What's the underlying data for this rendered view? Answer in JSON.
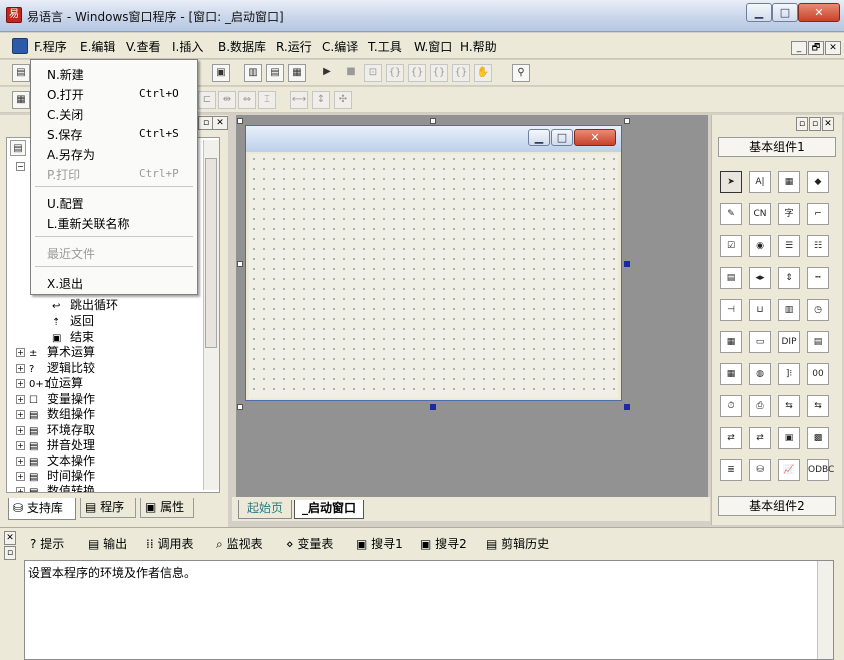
{
  "window": {
    "title": "易语言 - Windows窗口程序 - [窗口: _启动窗口]",
    "app_icon": "易",
    "min_label": "▁",
    "max_label": "□",
    "close_label": "✕"
  },
  "menubar": {
    "items": [
      {
        "label": "F.程序"
      },
      {
        "label": "E.编辑"
      },
      {
        "label": "V.查看"
      },
      {
        "label": "I.插入"
      },
      {
        "label": "B.数据库"
      },
      {
        "label": "R.运行"
      },
      {
        "label": "C.编译"
      },
      {
        "label": "T.工具"
      },
      {
        "label": "W.窗口"
      },
      {
        "label": "H.帮助"
      }
    ],
    "mdi_min": "_",
    "mdi_restore": "🗗",
    "mdi_close": "✕"
  },
  "file_menu": {
    "items": [
      {
        "label": "N.新建",
        "shortcut": "",
        "disabled": false
      },
      {
        "label": "O.打开",
        "shortcut": "Ctrl+O",
        "disabled": false
      },
      {
        "label": "C.关闭",
        "shortcut": "",
        "disabled": false
      },
      {
        "label": "S.保存",
        "shortcut": "Ctrl+S",
        "disabled": false
      },
      {
        "label": "A.另存为",
        "shortcut": "",
        "disabled": false
      },
      {
        "label": "P.打印",
        "shortcut": "Ctrl+P",
        "disabled": true
      },
      {
        "label": "U.配置",
        "shortcut": "",
        "disabled": false
      },
      {
        "label": "L.重新关联名称",
        "shortcut": "",
        "disabled": false
      },
      {
        "label": "最近文件",
        "shortcut": "",
        "disabled": true
      },
      {
        "label": "X.退出",
        "shortcut": "",
        "disabled": false
      }
    ]
  },
  "tree": {
    "children": [
      {
        "label": "跳出循环",
        "icon": "↩"
      },
      {
        "label": "返回",
        "icon": "⇡"
      },
      {
        "label": "结束",
        "icon": "▣"
      }
    ],
    "groups": [
      {
        "label": "算术运算",
        "icon": "±"
      },
      {
        "label": "逻辑比较",
        "icon": "?"
      },
      {
        "label": "位运算",
        "icon": "0+1"
      },
      {
        "label": "变量操作",
        "icon": "☐"
      },
      {
        "label": "数组操作",
        "icon": "▤"
      },
      {
        "label": "环境存取",
        "icon": "▤"
      },
      {
        "label": "拼音处理",
        "icon": "▤"
      },
      {
        "label": "文本操作",
        "icon": "▤"
      },
      {
        "label": "时间操作",
        "icon": "▤"
      },
      {
        "label": "数值转换",
        "icon": "▤"
      }
    ]
  },
  "left_tabs": [
    {
      "label": "支持库"
    },
    {
      "label": "程序"
    },
    {
      "label": "属性"
    }
  ],
  "designer_tabs": [
    {
      "label": "起始页"
    },
    {
      "label": "_启动窗口"
    }
  ],
  "palette": {
    "header_top": "基本组件1",
    "header_bottom": "基本组件2",
    "icons": [
      {
        "name": "pointer-icon",
        "glyph": "➤"
      },
      {
        "name": "label-icon",
        "glyph": "A|"
      },
      {
        "name": "picture-icon",
        "glyph": "▦"
      },
      {
        "name": "shape-icon",
        "glyph": "◆"
      },
      {
        "name": "edit-icon",
        "glyph": "✎"
      },
      {
        "name": "groupbox-icon",
        "glyph": "CN"
      },
      {
        "name": "text-icon",
        "glyph": "字"
      },
      {
        "name": "line-icon",
        "glyph": "⌐"
      },
      {
        "name": "checkbox-icon",
        "glyph": "☑"
      },
      {
        "name": "radio-icon",
        "glyph": "◉"
      },
      {
        "name": "listbox-icon",
        "glyph": "☰"
      },
      {
        "name": "combo-icon",
        "glyph": "☷"
      },
      {
        "name": "grid-icon",
        "glyph": "▤"
      },
      {
        "name": "hscroll-icon",
        "glyph": "◂▸"
      },
      {
        "name": "spin-icon",
        "glyph": "⇕"
      },
      {
        "name": "progress-icon",
        "glyph": "┅"
      },
      {
        "name": "slider-icon",
        "glyph": "⊣"
      },
      {
        "name": "tab-icon",
        "glyph": "⊔"
      },
      {
        "name": "vscroll-icon",
        "glyph": "▥"
      },
      {
        "name": "timer-icon",
        "glyph": "◷"
      },
      {
        "name": "calendar-icon",
        "glyph": "▦"
      },
      {
        "name": "button-icon",
        "glyph": "▭"
      },
      {
        "name": "dip-icon",
        "glyph": "DIP"
      },
      {
        "name": "doc-icon",
        "glyph": "▤"
      },
      {
        "name": "table-icon",
        "glyph": "▦"
      },
      {
        "name": "globe-icon",
        "glyph": "◍"
      },
      {
        "name": "bracket-icon",
        "glyph": "]⁝"
      },
      {
        "name": "panel-icon",
        "glyph": "00"
      },
      {
        "name": "clock-icon",
        "glyph": "⏱"
      },
      {
        "name": "printer-icon",
        "glyph": "⎙"
      },
      {
        "name": "network-icon",
        "glyph": "⇆"
      },
      {
        "name": "network2-icon",
        "glyph": "⇆"
      },
      {
        "name": "client-icon",
        "glyph": "⇄"
      },
      {
        "name": "server-icon",
        "glyph": "⇄"
      },
      {
        "name": "window-icon",
        "glyph": "▣"
      },
      {
        "name": "multi-icon",
        "glyph": "▩"
      },
      {
        "name": "stack-icon",
        "glyph": "≣"
      },
      {
        "name": "db-icon",
        "glyph": "⛁"
      },
      {
        "name": "chart-icon",
        "glyph": "📈"
      },
      {
        "name": "odbc-icon",
        "glyph": "ODBC"
      }
    ]
  },
  "bottom_tabs": [
    {
      "label": "提示",
      "icon": "?"
    },
    {
      "label": "输出",
      "icon": "▤"
    },
    {
      "label": "调用表",
      "icon": "⁞⁞"
    },
    {
      "label": "监视表",
      "icon": "⌕"
    },
    {
      "label": "变量表",
      "icon": "⋄"
    },
    {
      "label": "搜寻1",
      "icon": "▣"
    },
    {
      "label": "搜寻2",
      "icon": "▣"
    },
    {
      "label": "剪辑历史",
      "icon": "▤"
    }
  ],
  "output_text": "设置本程序的环境及作者信息。"
}
